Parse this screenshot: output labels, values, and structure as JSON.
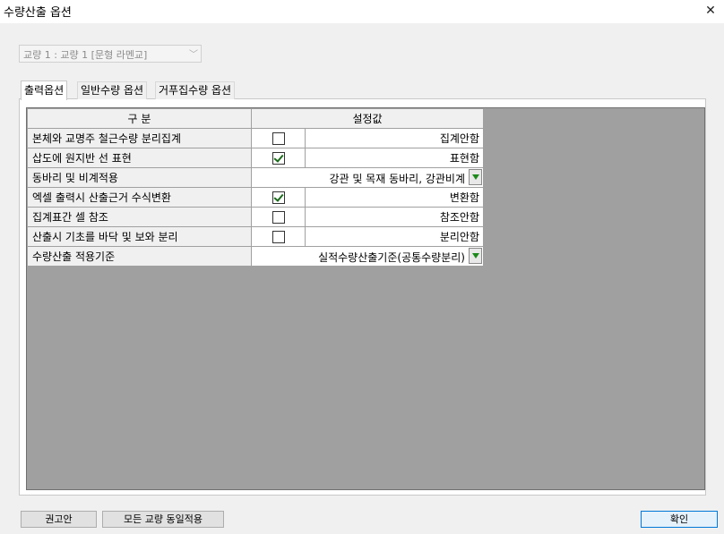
{
  "window": {
    "title": "수량산출 옵션",
    "close_glyph": "✕"
  },
  "bridge_select": {
    "value": "교량 1 : 교량 1 [문형 라멘교]",
    "arrow_icon": "chevron-down-icon"
  },
  "tabs": [
    {
      "label": "출력옵션",
      "active": true
    },
    {
      "label": "일반수량 옵션",
      "active": false
    },
    {
      "label": "거푸집수량 옵션",
      "active": false
    }
  ],
  "grid": {
    "headers": [
      "구  분",
      "설정값"
    ],
    "rows": [
      {
        "label": "본체와 교명주 철근수량 분리집계",
        "type": "checkbox",
        "checked": false,
        "value": "집계안함"
      },
      {
        "label": "삽도에 원지반 선 표현",
        "type": "checkbox",
        "checked": true,
        "value": "표현함"
      },
      {
        "label": "동바리 및 비계적용",
        "type": "dropdown",
        "value": "강관 및 목재 동바리, 강관비계"
      },
      {
        "label": "엑셀 출력시 산출근거 수식변환",
        "type": "checkbox",
        "checked": true,
        "value": "변환함"
      },
      {
        "label": "집계표간 셀 참조",
        "type": "checkbox",
        "checked": false,
        "value": "참조안함"
      },
      {
        "label": "산출시 기초를 바닥 및 보와 분리",
        "type": "checkbox",
        "checked": false,
        "value": "분리안함"
      },
      {
        "label": "수량산출 적용기준",
        "type": "dropdown",
        "value": "실적수량산출기준(공통수량분리)"
      }
    ]
  },
  "buttons": {
    "recommend": "권고안",
    "apply_all": "모든 교량 동일적용",
    "ok": "확인"
  },
  "colors": {
    "grid_background": "#a0a0a0",
    "header_background": "#f0f0f0",
    "dropdown_arrow": "#1b8a1b",
    "check_mark": "#1a6b1a"
  }
}
